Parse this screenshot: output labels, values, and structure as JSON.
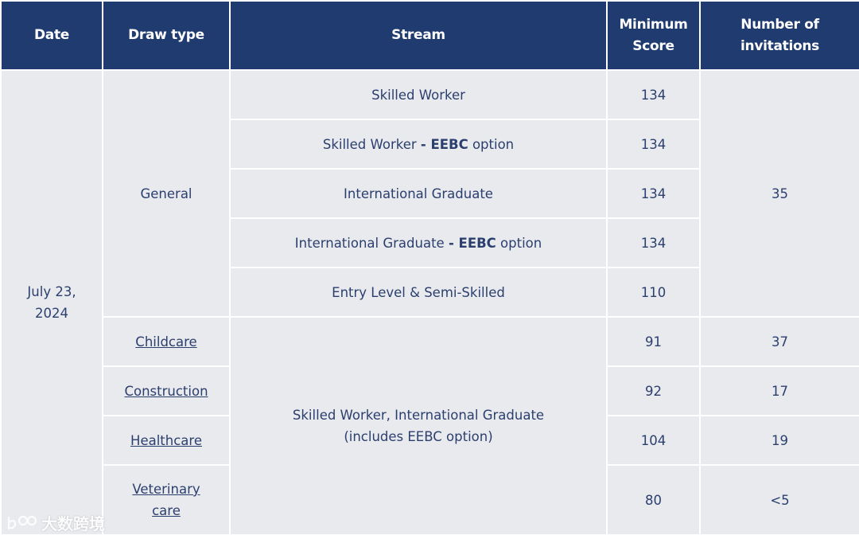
{
  "headers": {
    "date": "Date",
    "draw_type": "Draw type",
    "stream": "Stream",
    "min_score_line1": "Minimum",
    "min_score_line2": "Score",
    "invitations_line1": "Number of",
    "invitations_line2": "invitations"
  },
  "date": {
    "line1": "July 23,",
    "line2": "2024"
  },
  "general": {
    "draw_type": "General",
    "invitations": "35",
    "rows": [
      {
        "stream": "Skilled Worker",
        "score": "134"
      },
      {
        "stream_pre": "Skilled Worker ",
        "stream_bold": "- EEBC",
        "stream_post": " option",
        "score": "134"
      },
      {
        "stream": "International Graduate",
        "score": "134"
      },
      {
        "stream_pre": "International Graduate ",
        "stream_bold": "- EEBC",
        "stream_post": " option",
        "score": "134"
      },
      {
        "stream": "Entry Level & Semi-Skilled",
        "score": "110"
      }
    ]
  },
  "targeted": {
    "stream_line1": "Skilled Worker, International Graduate",
    "stream_line2": "(includes EEBC option)",
    "rows": [
      {
        "draw_type": "Childcare",
        "score": "91",
        "invitations": "37"
      },
      {
        "draw_type": "Construction",
        "score": "92",
        "invitations": "17"
      },
      {
        "draw_type": "Healthcare",
        "score": "104",
        "invitations": "19"
      },
      {
        "draw_type_line1": "Veterinary",
        "draw_type_line2": "care",
        "score": "80",
        "invitations": "<5"
      }
    ]
  },
  "watermark": {
    "text": "大数跨境",
    "icon": "brand-logo-icon"
  }
}
